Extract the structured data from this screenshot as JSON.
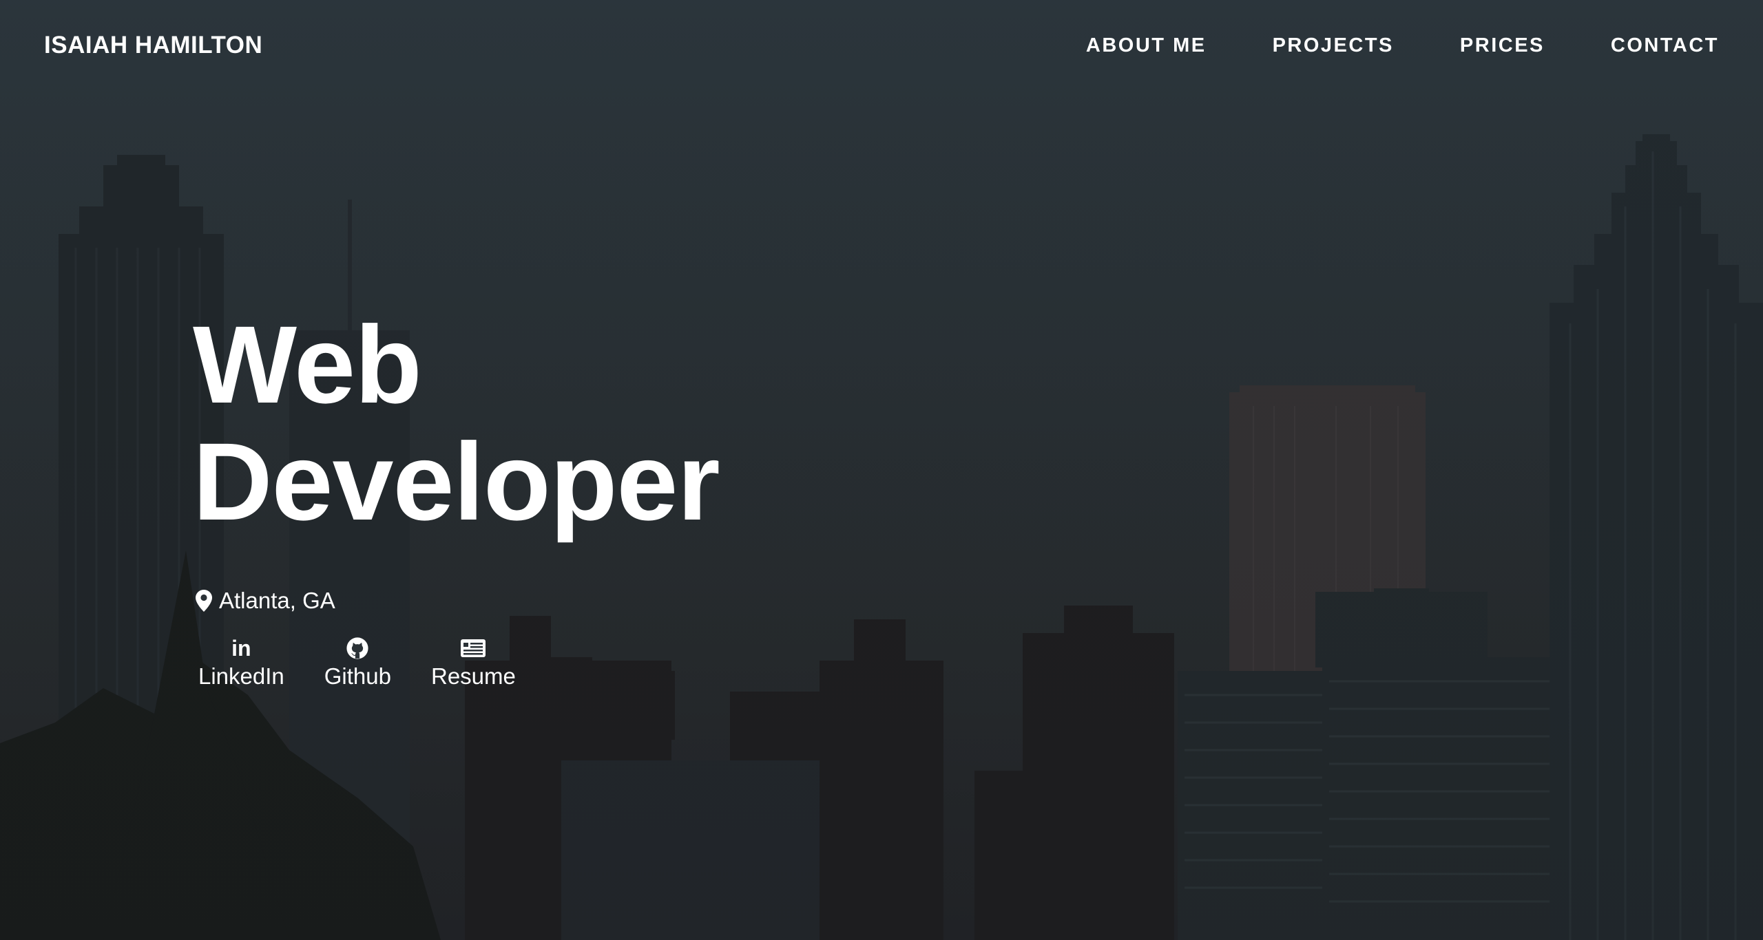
{
  "nav": {
    "brand": "ISAIAH HAMILTON",
    "items": [
      {
        "label": "ABOUT ME"
      },
      {
        "label": "PROJECTS"
      },
      {
        "label": "PRICES"
      },
      {
        "label": "CONTACT"
      }
    ]
  },
  "hero": {
    "title_line1": "Web",
    "title_line2": "Developer",
    "location": "Atlanta, GA",
    "links": [
      {
        "label": "LinkedIn",
        "icon": "linkedin-icon"
      },
      {
        "label": "Github",
        "icon": "github-icon"
      },
      {
        "label": "Resume",
        "icon": "resume-icon"
      }
    ],
    "linkedin_glyph": "in"
  },
  "colors": {
    "text": "#ffffff",
    "sky": "#2f3a41",
    "buildings": "#1c1f22"
  }
}
